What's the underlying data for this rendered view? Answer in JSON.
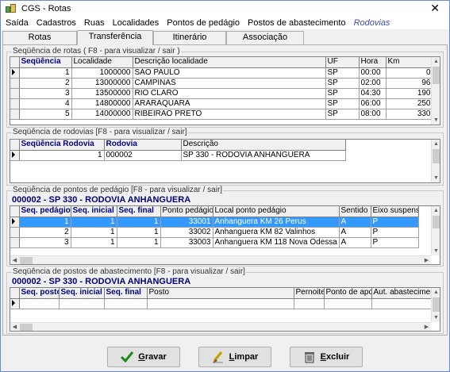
{
  "window": {
    "title": "CGS - Rotas"
  },
  "menu": [
    "Saída",
    "Cadastros",
    "Ruas",
    "Localidades",
    "Pontos de pedágio",
    "Postos de abastecimento",
    "Rodovias"
  ],
  "tabs": [
    "Rotas",
    "Transferência",
    "Itinerário",
    "Associação"
  ],
  "rotas": {
    "title": "Seqüência de rotas ( F8 - para visualizar / sair )",
    "headers": [
      "Seqüência",
      "Localidade",
      "Descrição localidade",
      "UF",
      "Hora",
      "Km"
    ],
    "rows": [
      [
        "1",
        "1000000",
        "SAO PAULO",
        "SP",
        "00:00",
        "0"
      ],
      [
        "2",
        "13000000",
        "CAMPINAS",
        "SP",
        "02:00",
        "96"
      ],
      [
        "3",
        "13500000",
        "RIO CLARO",
        "SP",
        "04:30",
        "190"
      ],
      [
        "4",
        "14800000",
        "ARARAQUARA",
        "SP",
        "06:00",
        "250"
      ],
      [
        "5",
        "14000000",
        "RIBEIRAO PRETO",
        "SP",
        "08:00",
        "330"
      ]
    ]
  },
  "rodovias": {
    "title": "Seqüência de rodovias [F8 - para visualizar / sair]",
    "headers": [
      "Seqüência Rodovia",
      "Rodovia",
      "Descrição"
    ],
    "rows": [
      [
        "1",
        "000002",
        "SP 330 - RODOVIA ANHANGUERA"
      ]
    ]
  },
  "pedagio": {
    "title": "Seqüência de pontos de pedágio [F8 - para visualizar / sair]",
    "subtitle": "000002 - SP 330 - RODOVIA ANHANGUERA",
    "headers": [
      "Seq. pedágio",
      "Seq. inicial",
      "Seq. final",
      "Ponto pedágio",
      "Local ponto pedágio",
      "Sentido",
      "Eixo suspenso"
    ],
    "rows": [
      [
        "1",
        "1",
        "1",
        "33001",
        "Anhanguera KM 26 Perus",
        "A",
        "P"
      ],
      [
        "2",
        "1",
        "1",
        "33002",
        "Anhanguera KM 82 Valinhos",
        "A",
        "P"
      ],
      [
        "3",
        "1",
        "1",
        "33003",
        "Anhanguera KM 118 Nova Odessa",
        "A",
        "P"
      ]
    ]
  },
  "postos": {
    "title": "Seqüência de postos de abastecimento [F8 - para visualizar / sair]",
    "subtitle": "000002 - SP 330 - RODOVIA ANHANGUERA",
    "headers": [
      "Seq. posto",
      "Seq. inicial",
      "Seq. final",
      "Posto",
      "Pernoite",
      "Ponto de apoio",
      "Aut. abastecimento"
    ]
  },
  "buttons": {
    "gravar_u": "G",
    "gravar_rest": "ravar",
    "limpar_u": "L",
    "limpar_rest": "impar",
    "excluir_u": "E",
    "excluir_rest": "xcluir"
  }
}
